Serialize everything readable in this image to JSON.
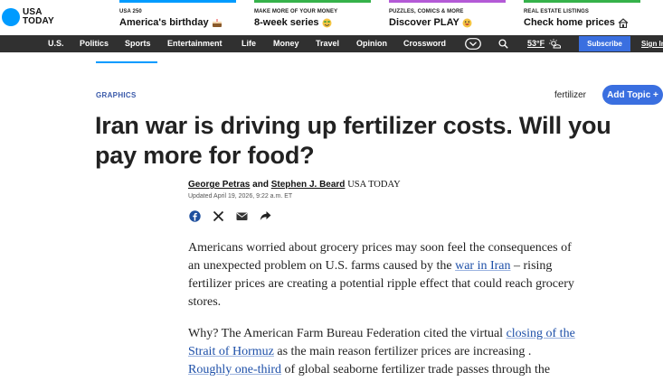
{
  "logo": {
    "line1": "USA",
    "line2": "TODAY"
  },
  "promos": [
    {
      "kicker": "USA 250",
      "headline": "America's birthday",
      "color": "#009bff",
      "emoji": "cake"
    },
    {
      "kicker": "MAKE MORE OF YOUR MONEY",
      "headline": "8-week series",
      "color": "#35b24a",
      "emoji": "money-face"
    },
    {
      "kicker": "PUZZLES, COMICS & MORE",
      "headline": "Discover PLAY",
      "color": "#b45ad6",
      "emoji": "grin"
    },
    {
      "kicker": "REAL ESTATE LISTINGS",
      "headline": "Check home prices",
      "color": "#35b24a",
      "emoji": "house"
    }
  ],
  "nav": {
    "items": [
      "U.S.",
      "Politics",
      "Sports",
      "Entertainment",
      "Life",
      "Money",
      "Travel",
      "Opinion",
      "Crossword"
    ],
    "temperature": "53°F",
    "subscribe": "Subscribe",
    "signin": "Sign In"
  },
  "article": {
    "section": "GRAPHICS",
    "topic": "fertilizer",
    "add_topic": "Add Topic +",
    "headline": "Iran war is driving up fertilizer costs. Will you pay more for food?",
    "author1": "George Petras",
    "and": " and ",
    "author2": "Stephen J. Beard",
    "outlet": "USA TODAY",
    "updated": "Updated April 19, 2026, 9:22 a.m. ET",
    "p1_a": "Americans worried about grocery prices may soon feel the consequences of an unexpected problem on U.S. farms caused by the ",
    "p1_link": "war in Iran",
    "p1_b": " – rising fertilizer prices are creating a potential ripple effect that could reach grocery stores.",
    "p2_a": "Why? The American Farm Bureau Federation cited the virtual ",
    "p2_link1": "closing of the Strait of Hormuz",
    "p2_b": " as the main reason fertilizer prices are increasing .",
    "p3_link": "Roughly one-third",
    "p3_b": " of global seaborne fertilizer trade passes through the"
  },
  "colors": {
    "brand": "#009bff",
    "nav_bg": "#303030",
    "button": "#3a6fe0",
    "link": "#1d4fa8"
  }
}
